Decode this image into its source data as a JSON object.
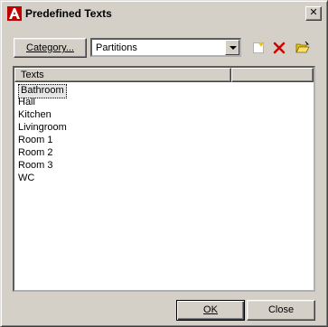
{
  "window": {
    "title": "Predefined Texts",
    "close_label": "✕"
  },
  "toolbar": {
    "category_label": "Category...",
    "category_value": "Partitions"
  },
  "list": {
    "columns": [
      "Texts",
      ""
    ],
    "items": [
      "Bathroom",
      "Hall",
      "Kitchen",
      "Livingroom",
      "Room 1",
      "Room 2",
      "Room 3",
      "WC"
    ],
    "selected_index": 0
  },
  "footer": {
    "ok_label": "OK",
    "close_label": "Close"
  },
  "colors": {
    "window_bg": "#d4d0c8",
    "delete_red": "#d40000"
  }
}
